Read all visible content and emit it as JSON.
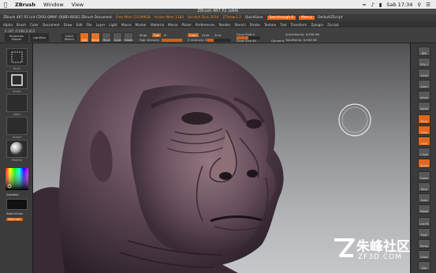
{
  "mac_menu": {
    "app": "ZBrush",
    "items": [
      "Window",
      "View"
    ],
    "status": {
      "time": "Sab 17:34"
    }
  },
  "window_title": "ZBrush 4R7 P2 (x64)",
  "zbrush_menu": {
    "info": "ZBrush 4R7 P2 [x4-CDSQ-QMHF-QQBD-BSSE] ZBrush Document",
    "mem": "Free Mem 23.099GB",
    "active_mem": "Active Mem 1184",
    "scratch": "Scratch Disk 2034",
    "ztime": "ZTime►1.2",
    "quicksave": "QuickSave",
    "see_through": "See-through 0",
    "menus": "Menus",
    "default_zscript": "DefaultZScript"
  },
  "menu_items": [
    "Alpha",
    "Brush",
    "Color",
    "Document",
    "Draw",
    "Edit",
    "File",
    "Layer",
    "Light",
    "Macro",
    "Marker",
    "Material",
    "Movie",
    "Picker",
    "Preferences",
    "Render",
    "Stencil",
    "Stroke",
    "Texture",
    "Tool",
    "Transform",
    "Zplugin",
    "Zscript"
  ],
  "shelf": {
    "coords": "0.187,-0.086,0.813",
    "projection_master": "Projection Master",
    "lightbox": "LightBox",
    "quick_sketch": "Quick Sketch",
    "tools": [
      "Edit",
      "Draw",
      "Move",
      "Scale",
      "Rotate"
    ],
    "mrgb": "Mrgb",
    "rgb": "Rgb",
    "m": "M",
    "rgb_intensity": "Rgb Intensity",
    "zadd": "Zadd",
    "zsub": "Zsub",
    "zcut": "Zcut",
    "z_intensity": "Z Intensity 25",
    "focal_shift": "Focal Shift 0",
    "draw_size": "Draw Size 64",
    "dynamic": "Dynamic",
    "active_points": "ActivePoints: 6.638 Mil",
    "total_points": "TotalPoints: 6.638 Mil"
  },
  "left_tray": {
    "tiles": [
      "Brush",
      "Stroke",
      "Alpha",
      "Texture",
      "Material"
    ],
    "gradient": "Gradient",
    "switch_color": "SwitchColor",
    "alternate": "Alternate"
  },
  "right_tray": {
    "buttons": [
      "BPR",
      "SPix 3",
      "Scroll",
      "Zoom",
      "Actual",
      "AAHalf",
      "Persp",
      "Floor",
      "Local",
      "L.Sym",
      "Xpose",
      "Frame",
      "Move",
      "Scale",
      "Rotate",
      "Line Fill",
      "PolyF",
      "Transp",
      "Ghost",
      "Solo"
    ]
  },
  "watermark": {
    "main": "朱峰社区",
    "sub": "ZF3D.COM"
  },
  "colors": {
    "accent": "#e8701f",
    "panel": "#3b3b3b",
    "canvas_top": "#515153",
    "canvas_bottom": "#c6c7ca"
  }
}
